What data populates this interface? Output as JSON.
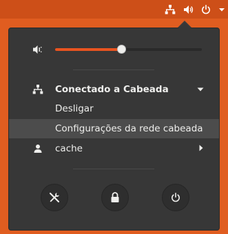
{
  "tray": {
    "network_icon": "network-wired-icon",
    "volume_icon": "speaker-icon",
    "power_icon": "power-icon",
    "dropdown_icon": "triangle-down-icon"
  },
  "menu": {
    "volume": {
      "icon": "speaker-icon",
      "level": 0.45
    },
    "network": {
      "icon": "network-wired-icon",
      "label": "Conectado a Cabeada",
      "items": [
        {
          "label": "Desligar"
        },
        {
          "label": "Configurações da rede cabeada"
        }
      ]
    },
    "user": {
      "icon": "user-icon",
      "label": "cache"
    },
    "actions": [
      {
        "name": "settings",
        "icon": "tools-icon"
      },
      {
        "name": "lock",
        "icon": "lock-icon"
      },
      {
        "name": "power-off",
        "icon": "power-icon"
      }
    ]
  },
  "colors": {
    "accent": "#e95420",
    "panel_bg": "#373737",
    "text": "#eeeeec"
  }
}
